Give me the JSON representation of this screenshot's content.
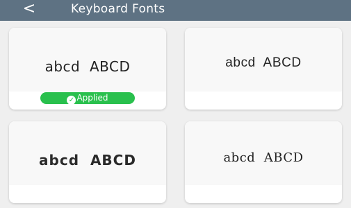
{
  "header": {
    "back_icon": "<",
    "title": "Keyboard Fonts"
  },
  "fonts": [
    {
      "preview": "abcd  ABCD",
      "applied": true,
      "badge_label": "Applied"
    },
    {
      "preview": "abcd  ABCD",
      "applied": false
    },
    {
      "preview": "abcd  ABCD",
      "applied": false
    },
    {
      "preview": "abcd  ABCD",
      "applied": false
    }
  ],
  "colors": {
    "appbar": "#5e7283",
    "applied_badge": "#29c04d"
  }
}
